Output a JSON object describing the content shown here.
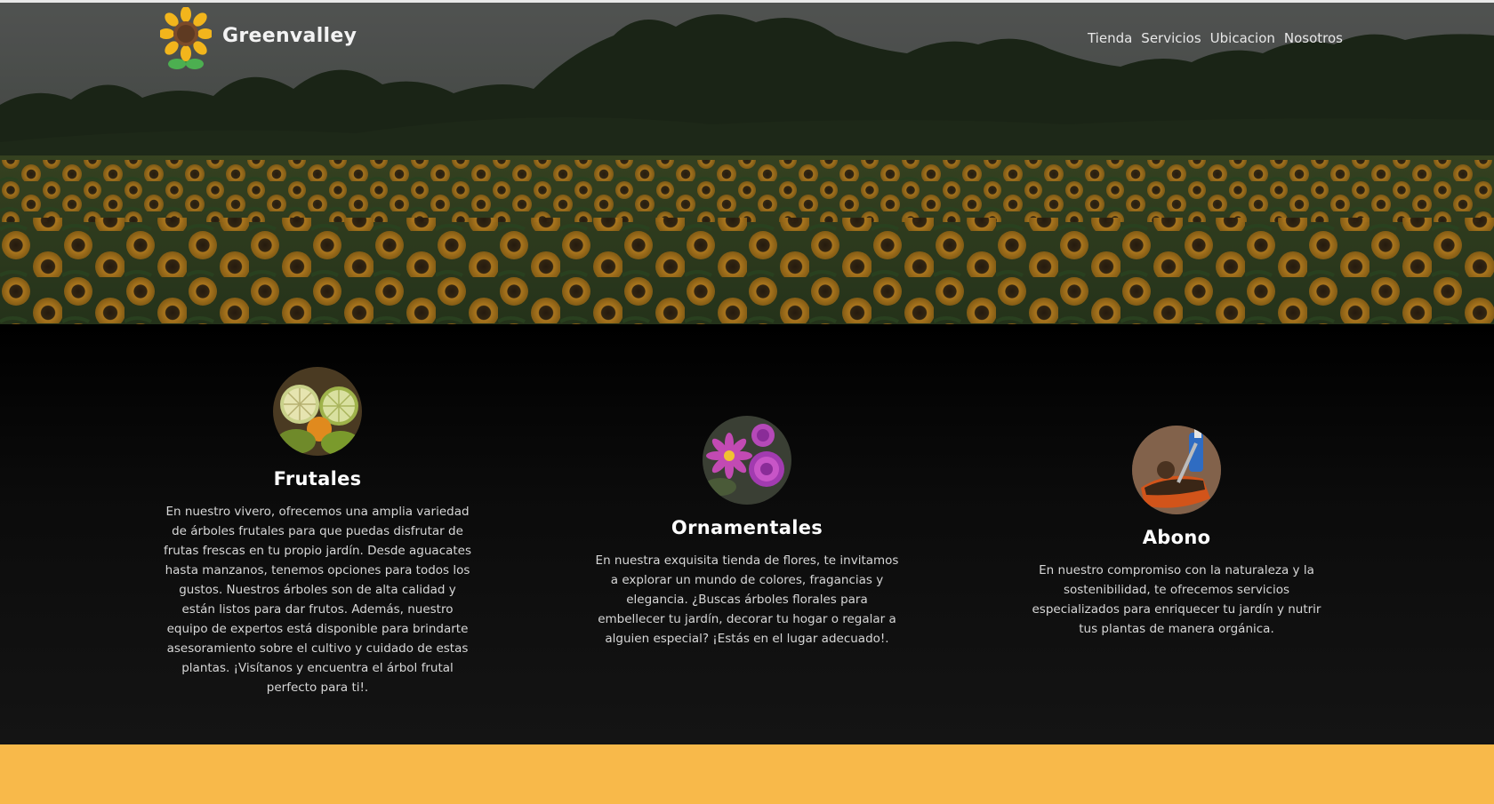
{
  "brand": {
    "name": "Greenvalley",
    "logo_icon": "sunflower-icon"
  },
  "nav": {
    "items": [
      {
        "label": "Tienda"
      },
      {
        "label": "Servicios"
      },
      {
        "label": "Ubicacion"
      },
      {
        "label": "Nosotros"
      }
    ]
  },
  "hero": {
    "image": "sunflower-field-image"
  },
  "services": [
    {
      "title": "Frutales",
      "image": "citrus-fruits-image",
      "text": "En nuestro vivero, ofrecemos una amplia variedad de árboles frutales para que puedas disfrutar de frutas frescas en tu propio jardín. Desde aguacates hasta manzanos, tenemos opciones para todos los gustos. Nuestros árboles son de alta calidad y están listos para dar frutos. Además, nuestro equipo de expertos está disponible para brindarte asesoramiento sobre el cultivo y cuidado de estas plantas. ¡Visítanos y encuentra el árbol frutal perfecto para ti!."
    },
    {
      "title": "Ornamentales",
      "image": "purple-flowers-image",
      "text": "En nuestra exquisita tienda de flores, te invitamos a explorar un mundo de colores, fragancias y elegancia. ¿Buscas árboles florales para embellecer tu jardín, decorar tu hogar o regalar a alguien especial? ¡Estás en el lugar adecuado!."
    },
    {
      "title": "Abono",
      "image": "soil-shovel-image",
      "text": "En nuestro compromiso con la naturaleza y la sostenibilidad, te ofrecemos servicios especializados para enriquecer tu jardín y nutrir tus plantas de manera orgánica."
    }
  ],
  "colors": {
    "accent": "#f8b94a",
    "services_bg": "#111111",
    "text_light": "#d7d7d7"
  }
}
